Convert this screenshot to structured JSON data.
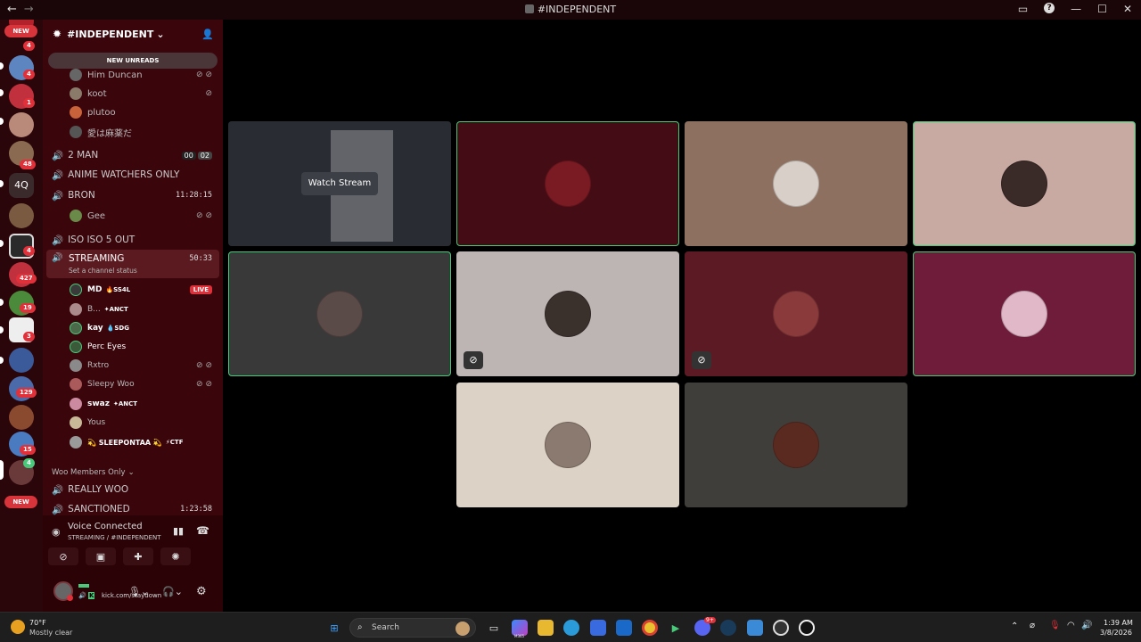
{
  "window": {
    "title": "#INDEPENDENT",
    "back": "←",
    "forward": "→"
  },
  "guilds": {
    "new_top": "NEW",
    "new_bottom": "NEW",
    "text_server": "4Q",
    "badges": [
      "4",
      "4",
      "1",
      "48",
      "4",
      "427",
      "19",
      "3",
      "129",
      "15",
      "4"
    ]
  },
  "server": {
    "name": "#INDEPENDENT",
    "chevron": "⌄"
  },
  "unreads": "NEW UNREADS",
  "channels": {
    "top_users": [
      {
        "name": "Him Duncan"
      },
      {
        "name": "koot"
      },
      {
        "name": "plutoo"
      },
      {
        "name": "愛は麻薬だ"
      }
    ],
    "two_man": {
      "name": "2 MAN",
      "count1": "00",
      "count2": "02"
    },
    "anime": {
      "name": "ANIME WATCHERS ONLY"
    },
    "bron": {
      "name": "BRON",
      "timer": "11:28:15",
      "users": [
        {
          "name": "Gee"
        }
      ]
    },
    "iso": {
      "name": "ISO ISO 5 OUT"
    },
    "streaming": {
      "name": "STREAMING",
      "timer": "50:33",
      "status": "Set a channel status",
      "users": [
        {
          "name": "MD",
          "tag": "SS4L",
          "tag_icon": "🔥",
          "live": "LIVE"
        },
        {
          "name": "B...",
          "tag": "ANCT",
          "tag_icon": "✦"
        },
        {
          "name": "kay",
          "tag": "SDG",
          "tag_icon": "💧"
        },
        {
          "name": "Perc Eyes"
        },
        {
          "name": "Rxtro"
        },
        {
          "name": "Sleepy Woo"
        },
        {
          "name": "swaz",
          "tag": "ANCT",
          "tag_icon": "✦"
        },
        {
          "name": "Yous"
        },
        {
          "name": "💫 SLEEPONTAA 💫",
          "tag": "CTF",
          "tag_icon": "⚡"
        }
      ]
    },
    "category": {
      "name": "Woo Members Only"
    },
    "really_woo": {
      "name": "REALLY WOO"
    },
    "sanctioned": {
      "name": "SANCTIONED",
      "timer": "1:23:58"
    }
  },
  "voice": {
    "status": "Voice Connected",
    "location": "STREAMING / #INDEPENDENT"
  },
  "user": {
    "status_text": "kick.com/staydown"
  },
  "stage": {
    "watch_stream": "Watch Stream"
  },
  "taskbar": {
    "temp": "70°F",
    "weather": "Mostly clear",
    "search": "Search",
    "time": "1:39 AM",
    "date": "3/8/2026",
    "m365": "M365",
    "discord_badge": "9+"
  },
  "colors": {
    "accent_green": "#49c97a",
    "live_red": "#e0303a",
    "sidebar_bg": "#3a050b"
  }
}
